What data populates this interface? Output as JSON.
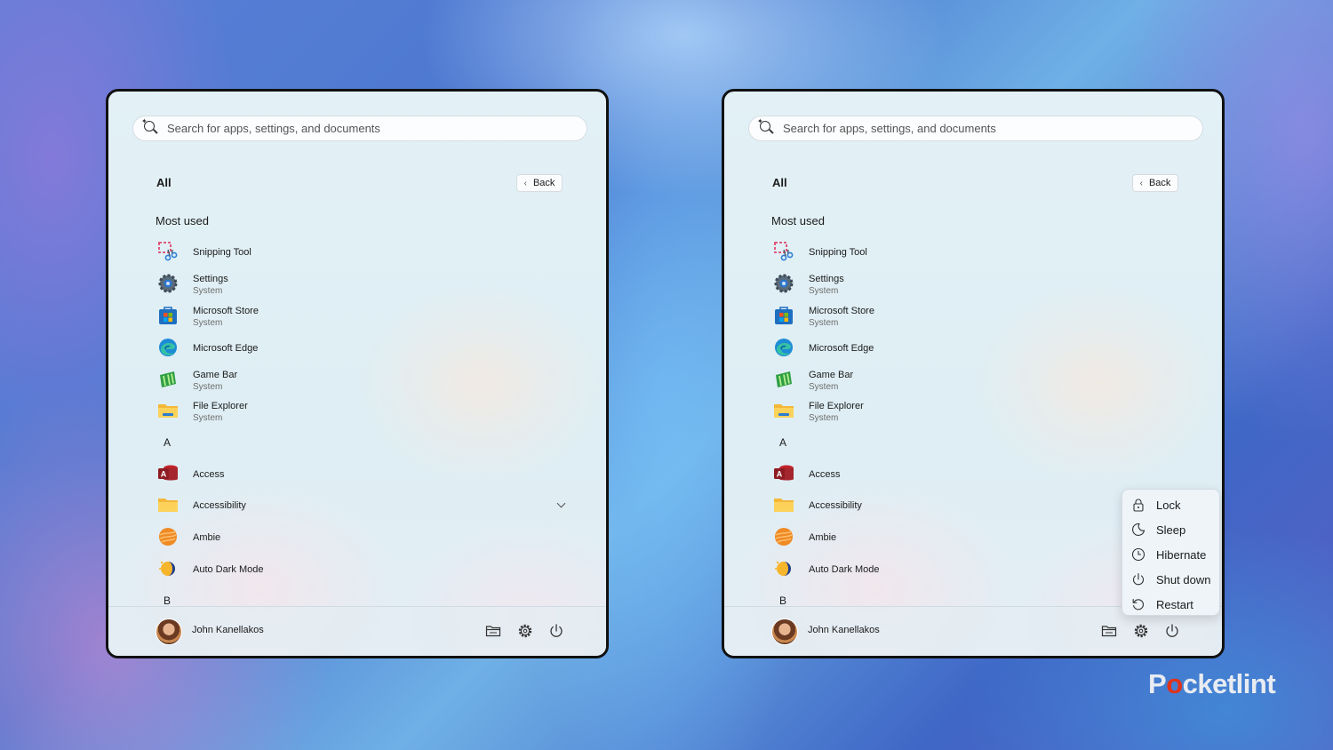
{
  "search": {
    "placeholder": "Search for apps, settings, and documents"
  },
  "header": {
    "all_label": "All",
    "back_label": "Back"
  },
  "sections": {
    "most_used": "Most used",
    "letter_a": "A",
    "letter_b": "B"
  },
  "most_used": [
    {
      "name": "Snipping Tool",
      "sub": "",
      "icon": "snipping-tool-icon"
    },
    {
      "name": "Settings",
      "sub": "System",
      "icon": "settings-app-icon"
    },
    {
      "name": "Microsoft Store",
      "sub": "System",
      "icon": "microsoft-store-icon"
    },
    {
      "name": "Microsoft Edge",
      "sub": "",
      "icon": "edge-icon"
    },
    {
      "name": "Game Bar",
      "sub": "System",
      "icon": "game-bar-icon"
    },
    {
      "name": "File Explorer",
      "sub": "System",
      "icon": "file-explorer-icon"
    }
  ],
  "a_apps": [
    {
      "name": "Access",
      "icon": "access-icon"
    },
    {
      "name": "Accessibility",
      "icon": "folder-icon"
    },
    {
      "name": "Ambie",
      "icon": "ambie-icon"
    },
    {
      "name": "Auto Dark Mode",
      "icon": "auto-dark-mode-icon"
    }
  ],
  "footer": {
    "user_name": "John Kanellakos"
  },
  "power_menu": {
    "items": [
      {
        "label": "Lock",
        "icon": "lock-icon"
      },
      {
        "label": "Sleep",
        "icon": "sleep-icon"
      },
      {
        "label": "Hibernate",
        "icon": "hibernate-icon"
      },
      {
        "label": "Shut down",
        "icon": "shut-down-icon"
      },
      {
        "label": "Restart",
        "icon": "restart-icon"
      }
    ]
  },
  "watermark": {
    "brand_pre": "P",
    "brand_o": "o",
    "brand_post": "cketlint"
  },
  "colors": {
    "accent": "#0067c0",
    "brand_red": "#e1321a",
    "panel_border": "#111111"
  }
}
